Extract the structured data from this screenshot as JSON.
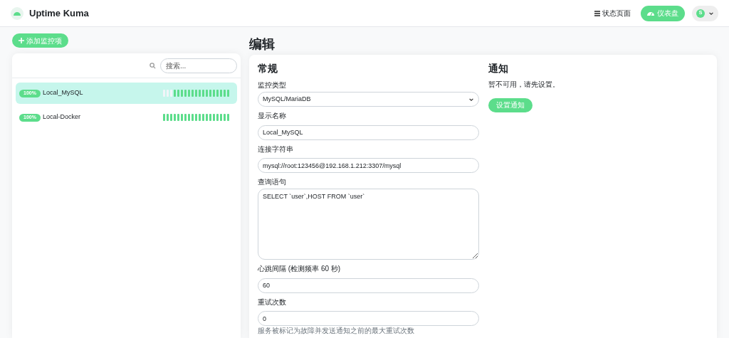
{
  "header": {
    "brand": "Uptime Kuma",
    "status_page_link": "状态页面",
    "dashboard_button": "仪表盘",
    "avatar_letter": "S"
  },
  "add_button": "添加监控项",
  "search": {
    "placeholder": "搜索..."
  },
  "monitors": [
    {
      "uptime": "100%",
      "name": "Local_MySQL",
      "selected": true,
      "beats": [
        {
          "up": false
        },
        {
          "up": false
        },
        {
          "up": false
        },
        {
          "up": true
        },
        {
          "up": true
        },
        {
          "up": true
        },
        {
          "up": true
        },
        {
          "up": true
        },
        {
          "up": true
        },
        {
          "up": true
        },
        {
          "up": true
        },
        {
          "up": true
        },
        {
          "up": true
        },
        {
          "up": true
        },
        {
          "up": true
        },
        {
          "up": true
        },
        {
          "up": true
        },
        {
          "up": true
        },
        {
          "up": true
        }
      ]
    },
    {
      "uptime": "100%",
      "name": "Local-Docker",
      "selected": false,
      "beats": [
        {
          "up": true
        },
        {
          "up": true
        },
        {
          "up": true
        },
        {
          "up": true
        },
        {
          "up": true
        },
        {
          "up": true
        },
        {
          "up": true
        },
        {
          "up": true
        },
        {
          "up": true
        },
        {
          "up": true
        },
        {
          "up": true
        },
        {
          "up": true
        },
        {
          "up": true
        },
        {
          "up": true
        },
        {
          "up": true
        },
        {
          "up": true
        },
        {
          "up": true
        },
        {
          "up": true
        },
        {
          "up": true
        }
      ]
    }
  ],
  "page_title": "编辑",
  "general": {
    "heading": "常规",
    "fields": [
      {
        "kind": "select",
        "label": "监控类型",
        "value": "MySQL/MariaDB"
      },
      {
        "kind": "input",
        "label": "显示名称",
        "value": "Local_MySQL"
      },
      {
        "kind": "input",
        "label": "连接字符串",
        "value": "mysql://root:123456@192.168.1.212:3307/mysql"
      },
      {
        "kind": "textarea",
        "label": "查询语句",
        "value": "SELECT `user`,HOST FROM `user`"
      },
      {
        "kind": "input",
        "label": "心跳间隔 (检测频率 60 秒)",
        "value": "60"
      },
      {
        "kind": "input",
        "label": "重试次数",
        "value": "0",
        "hint": "服务被标记为故障并发送通知之前的最大重试次数"
      }
    ]
  },
  "notifications": {
    "heading": "通知",
    "message": "暂不可用，请先设置。",
    "button": "设置通知"
  }
}
